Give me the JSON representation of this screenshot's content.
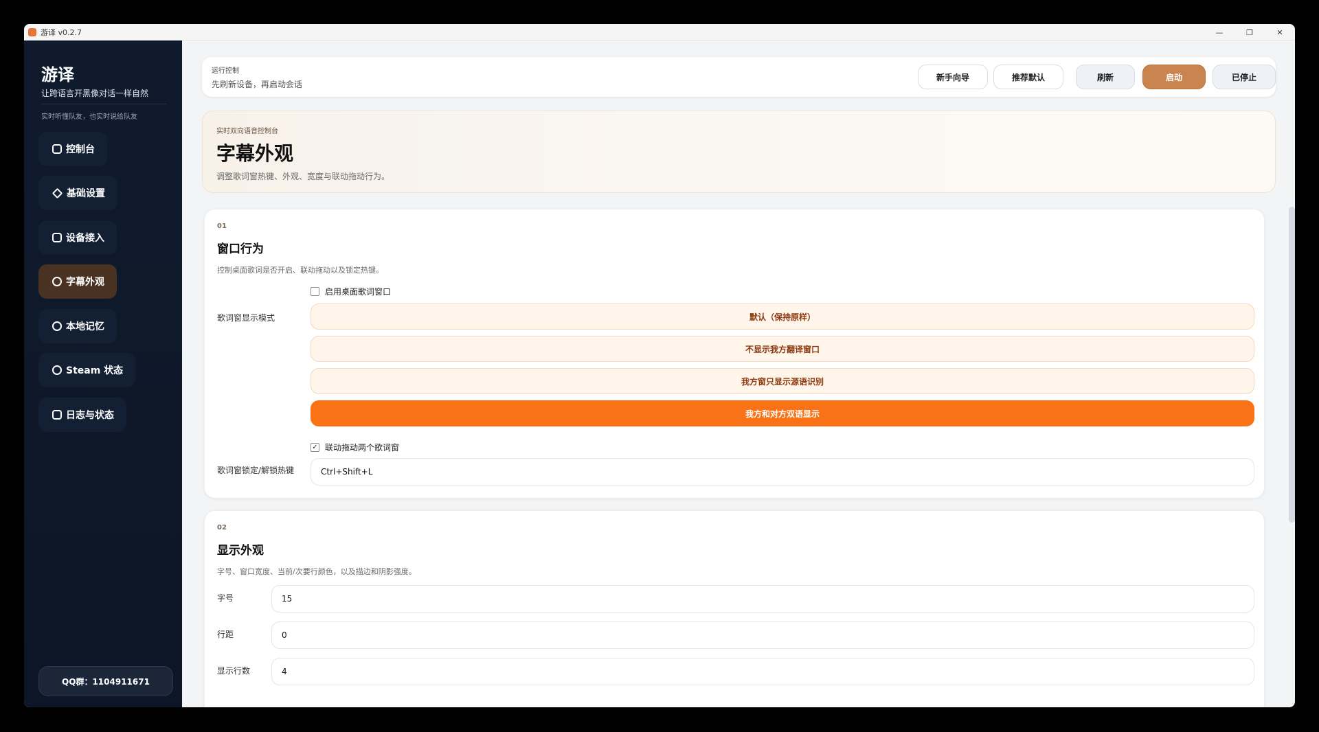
{
  "window": {
    "title": "游译 v0.2.7",
    "min": "—",
    "restore": "❐",
    "close": "✕"
  },
  "sidebar": {
    "brand": "游译",
    "tagline": "让跨语言开黑像对话一样自然",
    "subtag": "实时听懂队友，也实时说给队友",
    "items": [
      {
        "label": "控制台",
        "icon": "console-icon"
      },
      {
        "label": "基础设置",
        "icon": "settings-icon"
      },
      {
        "label": "设备接入",
        "icon": "device-icon"
      },
      {
        "label": "字幕外观",
        "icon": "subtitle-icon"
      },
      {
        "label": "本地记忆",
        "icon": "memory-icon"
      },
      {
        "label": "Steam 状态",
        "icon": "steam-icon"
      },
      {
        "label": "日志与状态",
        "icon": "log-icon"
      }
    ],
    "active_index": 3,
    "qq": "QQ群：1104911671"
  },
  "runbar": {
    "label": "运行控制",
    "hint": "先刷新设备，再启动会话",
    "buttons": {
      "guide": "新手向导",
      "recommend": "推荐默认",
      "refresh": "刷新",
      "start": "启动",
      "stopped": "已停止"
    }
  },
  "hero": {
    "kicker": "实时双向语音控制台",
    "title": "字幕外观",
    "desc": "调整歌词窗热键、外观、宽度与联动拖动行为。"
  },
  "section1": {
    "num": "01",
    "title": "窗口行为",
    "desc": "控制桌面歌词是否开启、联动拖动以及锁定热键。",
    "enable_label": "启用桌面歌词窗口",
    "enable_checked": false,
    "mode_label": "歌词窗显示模式",
    "modes": [
      "默认（保持原样）",
      "不显示我方翻译窗口",
      "我方窗只显示源语识别",
      "我方和对方双语显示"
    ],
    "selected_mode": 3,
    "link_label": "联动拖动两个歌词窗",
    "link_checked": true,
    "link_mark": "✓",
    "hotkey_label": "歌词窗锁定/解锁热键",
    "hotkey_value": "Ctrl+Shift+L"
  },
  "section2": {
    "num": "02",
    "title": "显示外观",
    "desc": "字号、窗口宽度、当前/次要行颜色，以及描边和阴影强度。",
    "fields": [
      {
        "label": "字号",
        "value": "15"
      },
      {
        "label": "行距",
        "value": "0"
      },
      {
        "label": "显示行数",
        "value": "4"
      }
    ]
  },
  "colors": {
    "accent": "#f97316",
    "primary_button": "#c9844f",
    "sidebar_bg": "#0f1b2d",
    "active_nav": "#4a3222"
  }
}
